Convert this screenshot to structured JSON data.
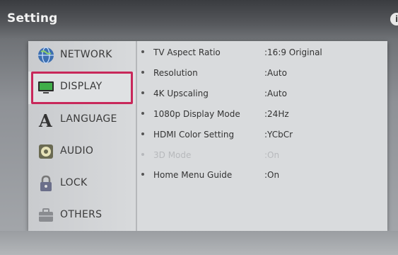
{
  "header": {
    "title": "Setting"
  },
  "sidebar": {
    "items": [
      {
        "label": "NETWORK",
        "icon": "globe-icon"
      },
      {
        "label": "DISPLAY",
        "icon": "monitor-icon"
      },
      {
        "label": "LANGUAGE",
        "icon": "letter-a-icon"
      },
      {
        "label": "AUDIO",
        "icon": "speaker-icon"
      },
      {
        "label": "LOCK",
        "icon": "padlock-icon"
      },
      {
        "label": "OTHERS",
        "icon": "briefcase-icon"
      }
    ],
    "selected": "DISPLAY"
  },
  "settings": [
    {
      "name": "TV Aspect Ratio",
      "value": ":16:9 Original",
      "enabled": true
    },
    {
      "name": "Resolution",
      "value": ":Auto",
      "enabled": true
    },
    {
      "name": "4K Upscaling",
      "value": ":Auto",
      "enabled": true
    },
    {
      "name": "1080p Display Mode",
      "value": ":24Hz",
      "enabled": true
    },
    {
      "name": "HDMI Color Setting",
      "value": ":YCbCr",
      "enabled": true
    },
    {
      "name": "3D Mode",
      "value": ":On",
      "enabled": false
    },
    {
      "name": "Home Menu Guide",
      "value": ":On",
      "enabled": true
    }
  ],
  "colors": {
    "focus": "#c8285a"
  }
}
